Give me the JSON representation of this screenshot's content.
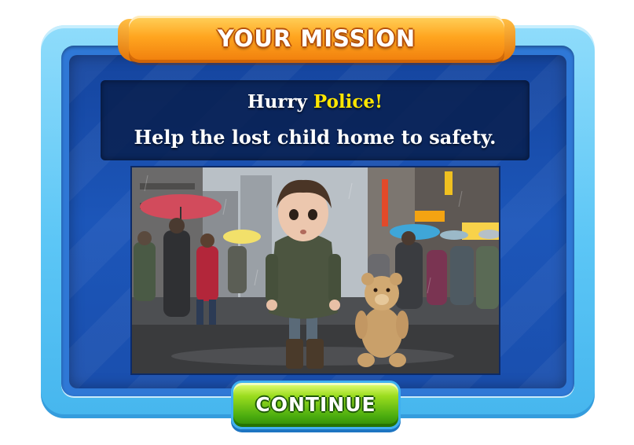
{
  "dialog": {
    "title": "YOUR MISSION",
    "message_line1_prefix": "Hurry ",
    "message_line1_highlight": "Police!",
    "message_line2": "Help the lost child home to safety.",
    "illustration_icon": "lost-child-with-teddy-bear-rainy-city-street",
    "continue_label": "CONTINUE"
  },
  "colors": {
    "frame": "#5cc6f6",
    "panel": "#1c56b9",
    "banner": "#ffa51f",
    "highlight": "#ffe600",
    "button": "#4cad0f"
  }
}
